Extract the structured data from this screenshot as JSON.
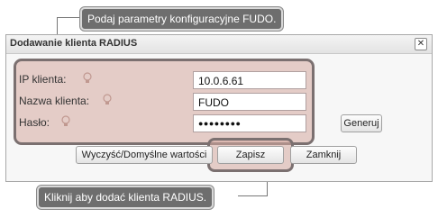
{
  "callouts": {
    "top": "Podaj parametry konfiguracyjne FUDO.",
    "bottom": "Kliknij aby dodać klienta RADIUS."
  },
  "dialog": {
    "title": "Dodawanie klienta RADIUS",
    "close_symbol": "✕"
  },
  "form": {
    "ip_label": "IP klienta:",
    "ip_value": "10.0.6.61",
    "name_label": "Nazwa klienta:",
    "name_value": "FUDO",
    "password_label": "Hasło:",
    "password_value": "●●●●●●●●",
    "hint_icon": "lightbulb-icon"
  },
  "buttons": {
    "generate": "Generuj",
    "clear_defaults": "Wyczyść/Domyślne wartości",
    "save": "Zapisz",
    "close": "Zamknij"
  },
  "colors": {
    "highlight": "#d6aaa0",
    "highlight_border": "#7b7070",
    "callout_bg": "#6e6e6e"
  }
}
